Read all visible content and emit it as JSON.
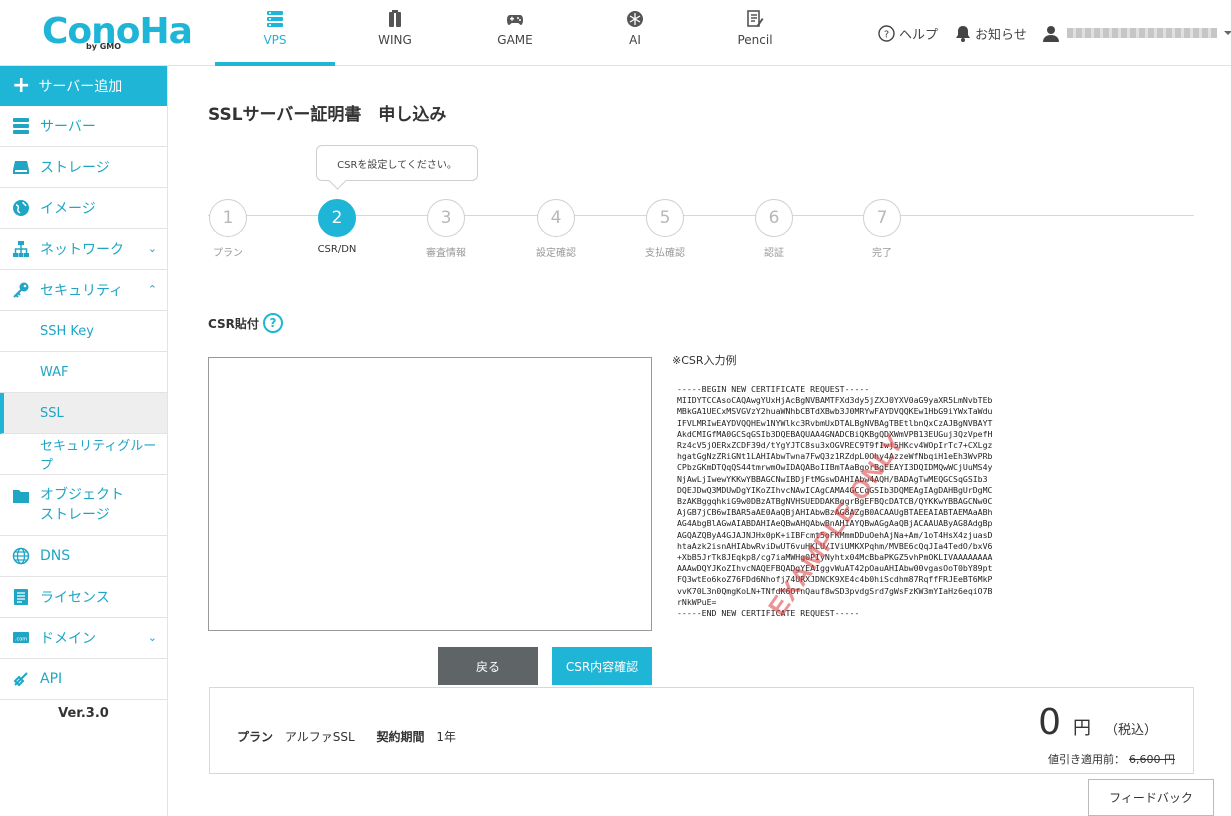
{
  "brand": {
    "name": "ConoHa",
    "sub": "by GMO",
    "color": "#1fb5d6"
  },
  "topnav": [
    {
      "label": "VPS",
      "icon": "server-stack-icon",
      "active": true
    },
    {
      "label": "WING",
      "icon": "wing-icon"
    },
    {
      "label": "GAME",
      "icon": "gamepad-icon"
    },
    {
      "label": "AI",
      "icon": "ai-icon"
    },
    {
      "label": "Pencil",
      "icon": "pencil-doc-icon"
    }
  ],
  "header": {
    "help": "ヘルプ",
    "notice": "お知らせ"
  },
  "sidebar": {
    "add": "サーバー追加",
    "items": [
      {
        "label": "サーバー",
        "icon": "server-icon"
      },
      {
        "label": "ストレージ",
        "icon": "storage-icon"
      },
      {
        "label": "イメージ",
        "icon": "image-icon"
      },
      {
        "label": "ネットワーク",
        "icon": "network-icon"
      },
      {
        "label": "セキュリティ",
        "icon": "key-icon"
      }
    ],
    "security_sub": [
      {
        "label": "SSH Key"
      },
      {
        "label": "WAF"
      },
      {
        "label": "SSL",
        "active": true
      },
      {
        "label": "セキュリティグループ"
      }
    ],
    "items2": [
      {
        "label": "オブジェクト\nストレージ",
        "l1": "オブジェクト",
        "l2": "ストレージ",
        "icon": "folder-icon"
      },
      {
        "label": "DNS",
        "icon": "globe-icon"
      },
      {
        "label": "ライセンス",
        "icon": "license-icon"
      },
      {
        "label": "ドメイン",
        "icon": "domain-icon"
      },
      {
        "label": "API",
        "icon": "api-icon"
      }
    ],
    "version": "Ver.3.0"
  },
  "main": {
    "title": "SSLサーバー証明書　申し込み",
    "tooltip": "CSRを設定してください。",
    "steps": [
      {
        "num": "1",
        "label": "プラン"
      },
      {
        "num": "2",
        "label": "CSR/DN",
        "active": true
      },
      {
        "num": "3",
        "label": "審査情報"
      },
      {
        "num": "4",
        "label": "設定確認"
      },
      {
        "num": "5",
        "label": "支払確認"
      },
      {
        "num": "6",
        "label": "認証"
      },
      {
        "num": "7",
        "label": "完了"
      }
    ],
    "csr_title": "CSR貼付",
    "csr_value": "",
    "example_label": "※CSR入力例",
    "example": "-----BEGIN NEW CERTIFICATE REQUEST-----\nMIIDYTCCAsoCAQAwgYUxHjAcBgNVBAMTFXd3dy5jZXJ0YXV0aG9yaXR5LmNvbTEb\nMBkGA1UECxMSVGVzY2huaWNhbCBTdXBwb3J0MRYwFAYDVQQKEw1HbG9iYWxTaWdu\nIFVLMRIwEAYDVQQHEw1NYWlkc3RvbmUxDTALBgNVBAgTBEtlbnQxCzAJBgNVBAYT\nAkdCMIGfMA0GCSqGSIb3DQEBAQUAA4GNADCBiQKBgQDXWmVPB13EUGuj3QzVpefH\nRz4cV5jOERxZCDF39d/tYgYJTC8su3xOGVREC9T9fIwj5HKcv4WOpIrTc7+CXLgz\nhgatGgNzZRiGNt1LAHIAbwTwna7FwQ3z1RZdpL0Ohy4AzzeWfNbqiH1eEh3WvPRb\nCPbzGKmDTQqQS44tmrwmOwIDAQABoIIBmTAaBgorBgEEAYI3DQIDMQwWCjUuMS4y\nNjAwLjIwewYKKwYBBAGCNwIBDjFtMGswDAHIAbw4AQH/BADAgTwMEQGCSqGSIb3\nDQEJDwQ3MDUwDgYIKoZIhvcNAwICAgCAMA4GCCqGSIb3DQMEAgIAgDAHBgUrDgMC\nBzAKBggqhkiG9w0DBzATBgNVHSUEDDAKBggrBgEFBQcDATCB/QYKKwYBBAGCNw0C\nAjGB7jCB6wIBAR5aAE0AaQBjAHIAbwBzAG8AZgB0ACAAUgBTAEEAIABTAEMAaABh\nAG4AbgBlAGwAIABDAHIAeQBwAHQAbwBnAHIAYQBwAGgAaQBjACAAUAByAG8AdgBp\nAGQAZQByA4GJAJNJHx0pK+iIBFcmt5oFKMmmDDuOehAjNa+Am/1oT4HsX4zjuasD\nhtaAzk2isnAHIAbwRviDwUT6vuHKLU/IViUMKXPqhm/MVBE6cQqJIa4TedO/bxV6\n+XbB5JrTk8JEqkp8/cg7iaMWHg0PIyNyhtx04McBbaPKGZ5vhPmOKLIVAAAAAAAA\nAAAwDQYJKoZIhvcNAQEFBQADgYEAIggvWuAT42pOauAHIAbw00vgasOoT0bY89pt\nFQ3wtEo6koZ76FDd6Nhofj74URXJDNCK9XE4c4b0hiScdhm87RqffFRJEeBT6MkP\nvvK70L3n0QmgKoLN+TNfdK6OfnQauf8wSD3pvdgSrd7gWsFzKW3mYIaHz6eqiO7B\nrNkWPuE=\n-----END NEW CERTIFICATE REQUEST-----",
    "watermark": "EXAMPLE ONLY",
    "btn_back": "戻る",
    "btn_confirm": "CSR内容確認"
  },
  "summary": {
    "plan_label": "プラン",
    "plan_value": "アルファSSL",
    "term_label": "契約期間",
    "term_value": "1年",
    "price": "0",
    "yen": "円",
    "tax": "（税込）",
    "discount_label": "値引き適用前：",
    "discount_value": "6,600 円"
  },
  "feedback": "フィードバック"
}
